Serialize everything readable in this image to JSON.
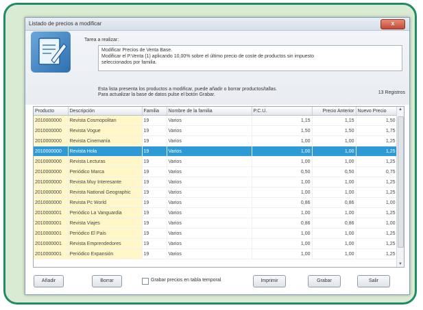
{
  "window": {
    "title": "Listado de precios a modificar",
    "close_label": "X"
  },
  "task": {
    "label": "Tarea a realizar:",
    "lines": [
      "Modificar Precios de Venta Base.",
      "Modificar el P.Venta (1) aplicando 10,00% sobre el último precio de coste de productos sin impuesto",
      "seleccionados por familia."
    ]
  },
  "info": {
    "line1": "Esta lista presenta los productos a modificar, puede añadir o borrar productos/tallas.",
    "line2": "Para actualizar la base de datos pulse el botón Grabar.",
    "registros": "13 Registros"
  },
  "table": {
    "columns": [
      "Producto",
      "Descripción",
      "Familia",
      "Nombre de la familia",
      "P.C.U.",
      "Precio Anterior",
      "Nuevo Precio"
    ],
    "selected_row": 3,
    "rows": [
      [
        "2010000000",
        "Revista Cosmopolitan",
        "19",
        "Varios",
        "1,15",
        "1,15",
        "1,50"
      ],
      [
        "2010000000",
        "Revista Vogue",
        "19",
        "Varios",
        "1,50",
        "1,50",
        "1,75"
      ],
      [
        "2010000000",
        "Revista Cinemanía",
        "19",
        "Varios",
        "1,00",
        "1,00",
        "1,25"
      ],
      [
        "2010000000",
        "Revista Hola",
        "19",
        "Varios",
        "1,00",
        "1,00",
        "1,25"
      ],
      [
        "2010000000",
        "Revista Lecturas",
        "19",
        "Varios",
        "1,00",
        "1,00",
        "1,25"
      ],
      [
        "2010000000",
        "Periódico Marca",
        "19",
        "Varios",
        "0,50",
        "0,50",
        "0,75"
      ],
      [
        "2010000000",
        "Revista Muy Interesante",
        "19",
        "Varios",
        "1,00",
        "1,00",
        "1,25"
      ],
      [
        "2010000000",
        "Revista National Geographic",
        "19",
        "Varios",
        "1,00",
        "1,00",
        "1,25"
      ],
      [
        "2010000000",
        "Revista Pc World",
        "19",
        "Varios",
        "0,86",
        "0,86",
        "1,00"
      ],
      [
        "2010000001",
        "Periódico La Vanguardia",
        "19",
        "Varios",
        "1,00",
        "1,00",
        "1,25"
      ],
      [
        "2010000001",
        "Revista Viajes",
        "19",
        "Varios",
        "0,86",
        "0,86",
        "1,00"
      ],
      [
        "2010000001",
        "Periódico El País",
        "19",
        "Varios",
        "1,00",
        "1,00",
        "1,25"
      ],
      [
        "2010000001",
        "Revista Emprendedores",
        "19",
        "Varios",
        "1,00",
        "1,00",
        "1,25"
      ],
      [
        "2010000001",
        "Periódico Expansión",
        "19",
        "Varios",
        "1,00",
        "1,00",
        "1,25"
      ]
    ]
  },
  "buttons": {
    "anadir": "Añadir",
    "borrar": "Borrar",
    "grabar_temporal": "Grabar precios en tabla temporal",
    "imprimir": "Imprimir",
    "grabar": "Grabar",
    "salir": "Salir"
  }
}
